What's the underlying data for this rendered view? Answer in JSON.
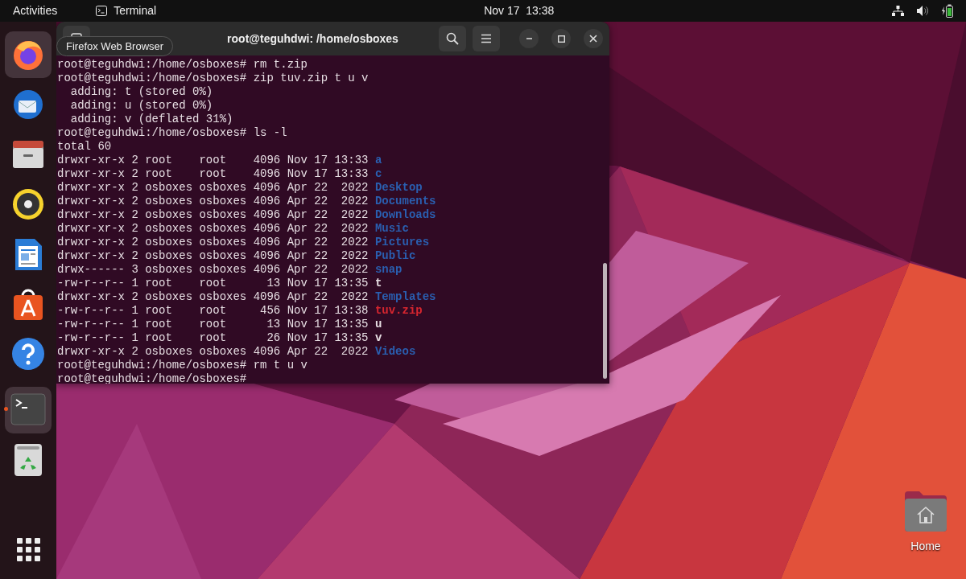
{
  "top_bar": {
    "activities": "Activities",
    "app_menu": "Terminal",
    "clock": "Nov 17  13:38"
  },
  "dock": {
    "items": [
      {
        "kind": "browser",
        "highlighted": true,
        "running": false
      },
      {
        "kind": "mail",
        "highlighted": false,
        "running": false
      },
      {
        "kind": "files",
        "highlighted": false,
        "running": false
      },
      {
        "kind": "music",
        "highlighted": false,
        "running": false
      },
      {
        "kind": "writer",
        "highlighted": false,
        "running": false
      },
      {
        "kind": "store",
        "highlighted": false,
        "running": false
      },
      {
        "kind": "help",
        "highlighted": false,
        "running": false
      },
      {
        "kind": "terminal",
        "highlighted": true,
        "running": true
      },
      {
        "kind": "trash",
        "highlighted": false,
        "running": false
      }
    ],
    "tooltip": "Firefox Web Browser"
  },
  "terminal": {
    "title": "root@teguhdwi: /home/osboxes",
    "lines": [
      {
        "kind": "plain",
        "text": "root@teguhdwi:/home/osboxes# rm t.zip"
      },
      {
        "kind": "plain",
        "text": "root@teguhdwi:/home/osboxes# zip tuv.zip t u v"
      },
      {
        "kind": "plain",
        "text": "  adding: t (stored 0%)"
      },
      {
        "kind": "plain",
        "text": "  adding: u (stored 0%)"
      },
      {
        "kind": "plain",
        "text": "  adding: v (deflated 31%)"
      },
      {
        "kind": "plain",
        "text": "root@teguhdwi:/home/osboxes# ls -l"
      },
      {
        "kind": "plain",
        "text": "total 60"
      },
      {
        "kind": "listing",
        "info": "drwxr-xr-x 2 root    root    4096 Nov 17 13:33",
        "name": "a",
        "color": "#2a5fb0"
      },
      {
        "kind": "listing",
        "info": "drwxr-xr-x 2 root    root    4096 Nov 17 13:33",
        "name": "c",
        "color": "#2a5fb0"
      },
      {
        "kind": "listing",
        "info": "drwxr-xr-x 2 osboxes osboxes 4096 Apr 22  2022",
        "name": "Desktop",
        "color": "#2a5fb0"
      },
      {
        "kind": "listing",
        "info": "drwxr-xr-x 2 osboxes osboxes 4096 Apr 22  2022",
        "name": "Documents",
        "color": "#2a5fb0"
      },
      {
        "kind": "listing",
        "info": "drwxr-xr-x 2 osboxes osboxes 4096 Apr 22  2022",
        "name": "Downloads",
        "color": "#2a5fb0"
      },
      {
        "kind": "listing",
        "info": "drwxr-xr-x 2 osboxes osboxes 4096 Apr 22  2022",
        "name": "Music",
        "color": "#2a5fb0"
      },
      {
        "kind": "listing",
        "info": "drwxr-xr-x 2 osboxes osboxes 4096 Apr 22  2022",
        "name": "Pictures",
        "color": "#2a5fb0"
      },
      {
        "kind": "listing",
        "info": "drwxr-xr-x 2 osboxes osboxes 4096 Apr 22  2022",
        "name": "Public",
        "color": "#2a5fb0"
      },
      {
        "kind": "listing",
        "info": "drwx------ 3 osboxes osboxes 4096 Apr 22  2022",
        "name": "snap",
        "color": "#2a5fb0"
      },
      {
        "kind": "listing",
        "info": "-rw-r--r-- 1 root    root      13 Nov 17 13:35",
        "name": "t",
        "color": "#e6dde2"
      },
      {
        "kind": "listing",
        "info": "drwxr-xr-x 2 osboxes osboxes 4096 Apr 22  2022",
        "name": "Templates",
        "color": "#2a5fb0"
      },
      {
        "kind": "listing",
        "info": "-rw-r--r-- 1 root    root     456 Nov 17 13:38",
        "name": "tuv.zip",
        "color": "#d7262f"
      },
      {
        "kind": "listing",
        "info": "-rw-r--r-- 1 root    root      13 Nov 17 13:35",
        "name": "u",
        "color": "#e6dde2"
      },
      {
        "kind": "listing",
        "info": "-rw-r--r-- 1 root    root      26 Nov 17 13:35",
        "name": "v",
        "color": "#e6dde2"
      },
      {
        "kind": "listing",
        "info": "drwxr-xr-x 2 osboxes osboxes 4096 Apr 22  2022",
        "name": "Videos",
        "color": "#2a5fb0"
      },
      {
        "kind": "plain",
        "text": "root@teguhdwi:/home/osboxes# rm t u v"
      },
      {
        "kind": "plain",
        "text": "root@teguhdwi:/home/osboxes#"
      }
    ]
  },
  "desktop_icons": [
    {
      "label": "Home"
    }
  ]
}
